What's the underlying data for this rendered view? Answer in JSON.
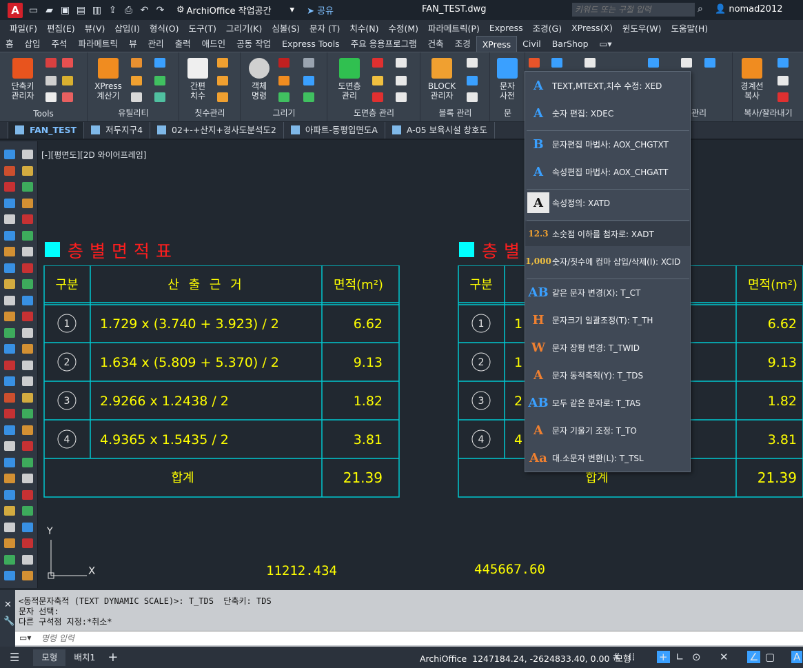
{
  "titlebar": {
    "logo": "A",
    "workspace": "ArchiOffice 작업공간",
    "share": "공유",
    "filename": "FAN_TEST.dwg",
    "search_placeholder": "키워드 또는 구절 입력",
    "user": "nomad2012"
  },
  "menubar": [
    "파일(F)",
    "편집(E)",
    "뷰(V)",
    "삽입(I)",
    "형식(O)",
    "도구(T)",
    "그리기(K)",
    "심볼(S)",
    "문자 (T)",
    "치수(N)",
    "수정(M)",
    "파라메트릭(P)",
    "Express",
    "조경(G)",
    "XPress(X)",
    "윈도우(W)",
    "도움말(H)"
  ],
  "ribbon_tabs": [
    "홈",
    "삽입",
    "주석",
    "파라메트릭",
    "뷰",
    "관리",
    "출력",
    "애드인",
    "공동 작업",
    "Express Tools",
    "주요 응용프로그램",
    "건축",
    "조경",
    "XPress",
    "Civil",
    "BarShop"
  ],
  "ribbon_active_tab": "XPress",
  "ribbon_panels": [
    {
      "label": "Tools",
      "button": "단축키\n관리자"
    },
    {
      "label": "유틸리티",
      "button": "XPress\n계산기"
    },
    {
      "label": "칫수관리",
      "button": "간편\n치수"
    },
    {
      "label": "그리기",
      "button": "객체\n명령"
    },
    {
      "label": "도면층 관리",
      "button": "도면층\n관리"
    },
    {
      "label": "블록 관리",
      "button": "BLOCK\n관리자"
    },
    {
      "label": "문",
      "button": "문자\n사전"
    },
    {
      "label": "관리",
      "button": ""
    },
    {
      "label": "복사/잘라내기",
      "button": "경계선\n복사"
    }
  ],
  "doc_tabs": [
    "FAN_TEST",
    "저두지구4",
    "02+-+산지+경사도분석도2",
    "아파트-동평입면도A",
    "A-05 보육시설 창호도"
  ],
  "active_doc_tab": "FAN_TEST",
  "drawing": {
    "view_label": "[-][평면도][2D 와이어프레임]",
    "table1": {
      "title": "층별면적표",
      "headers": [
        "구분",
        "산 출 근 거",
        "면적(m²)"
      ],
      "rows": [
        {
          "no": "1",
          "formula": "1.729 x (3.740 + 3.923) / 2",
          "area": "6.62"
        },
        {
          "no": "2",
          "formula": "1.634 x (5.809 + 5.370) / 2",
          "area": "9.13"
        },
        {
          "no": "3",
          "formula": "2.9266 x 1.2438 / 2",
          "area": "1.82"
        },
        {
          "no": "4",
          "formula": "4.9365 x 1.5435 / 2",
          "area": "3.81"
        }
      ],
      "total_label": "합계",
      "total_area": "21.39"
    },
    "table2": {
      "title": "층별",
      "headers": [
        "구분",
        "",
        "면적(m²)"
      ],
      "rows": [
        {
          "no": "1",
          "formula": "1",
          "area": "6.62"
        },
        {
          "no": "2",
          "formula": "1",
          "area": "9.13"
        },
        {
          "no": "3",
          "formula": "2",
          "area": "1.82"
        },
        {
          "no": "4",
          "formula": "4",
          "area": "3.81"
        }
      ],
      "total_label": "합계",
      "total_area": "21.39"
    },
    "coord1": "11212.434",
    "coord2": "445667.60",
    "ucs_x": "X",
    "ucs_y": "Y"
  },
  "flyout": {
    "items": [
      {
        "label": "TEXT,MTEXT,치수 수정: XED",
        "icon": "text-edit-icon",
        "glyph": "A",
        "color": "#3aa0ff"
      },
      {
        "label": "숫자 편집: XDEC",
        "icon": "number-edit-icon",
        "glyph": "A",
        "color": "#3aa0ff"
      },
      {
        "label": "문자편집 마법사: AOX_CHGTXT",
        "icon": "text-wizard-icon",
        "glyph": "B",
        "color": "#3aa0ff"
      },
      {
        "label": "속성편집 마법사: AOX_CHGATT",
        "icon": "attr-wizard-icon",
        "glyph": "A",
        "color": "#3aa0ff"
      },
      {
        "label": "속성정의: XATD",
        "icon": "attr-define-icon",
        "glyph": "A",
        "color": "#111111"
      },
      {
        "label": "소숫점 이하를 첨자로: XADT",
        "icon": "superscript-icon",
        "glyph": "12.3",
        "color": "#f0a030"
      },
      {
        "label": "숫자/칫수에 컴마 삽입/삭제(I): XCID",
        "icon": "comma-icon",
        "glyph": "1,000",
        "color": "#f0c040"
      },
      {
        "label": "같은 문자 변경(X): T_CT",
        "icon": "same-text-icon",
        "glyph": "AB",
        "color": "#3aa0ff"
      },
      {
        "label": "문자크기 일괄조정(T): T_TH",
        "icon": "text-height-icon",
        "glyph": "H",
        "color": "#f08030"
      },
      {
        "label": "문자 장평 변경: T_TWID",
        "icon": "text-width-icon",
        "glyph": "W",
        "color": "#f08030"
      },
      {
        "label": "문자 동적축척(Y): T_TDS",
        "icon": "dynamic-scale-icon",
        "glyph": "A",
        "color": "#f08030"
      },
      {
        "label": "모두 같은 문자로: T_TAS",
        "icon": "all-same-text-icon",
        "glyph": "AB",
        "color": "#3aa0ff"
      },
      {
        "label": "문자 기울기 조정: T_TO",
        "icon": "text-oblique-icon",
        "glyph": "A",
        "color": "#f08030"
      },
      {
        "label": "대.소문자 변환(L): T_TSL",
        "icon": "case-convert-icon",
        "glyph": "Aa",
        "color": "#f08030"
      }
    ]
  },
  "command": {
    "history": [
      "<동적문자축적 (TEXT DYNAMIC SCALE)>: T_TDS  단축키: TDS",
      "문자 선택:",
      "다른 구석점 지정:*취소*"
    ],
    "placeholder": "명령 입력"
  },
  "statusbar": {
    "tabs": [
      "모형",
      "배치1"
    ],
    "app": "ArchiOffice",
    "coords": "1247184.24, -2624833.40, 0.00",
    "mode": "모형"
  }
}
